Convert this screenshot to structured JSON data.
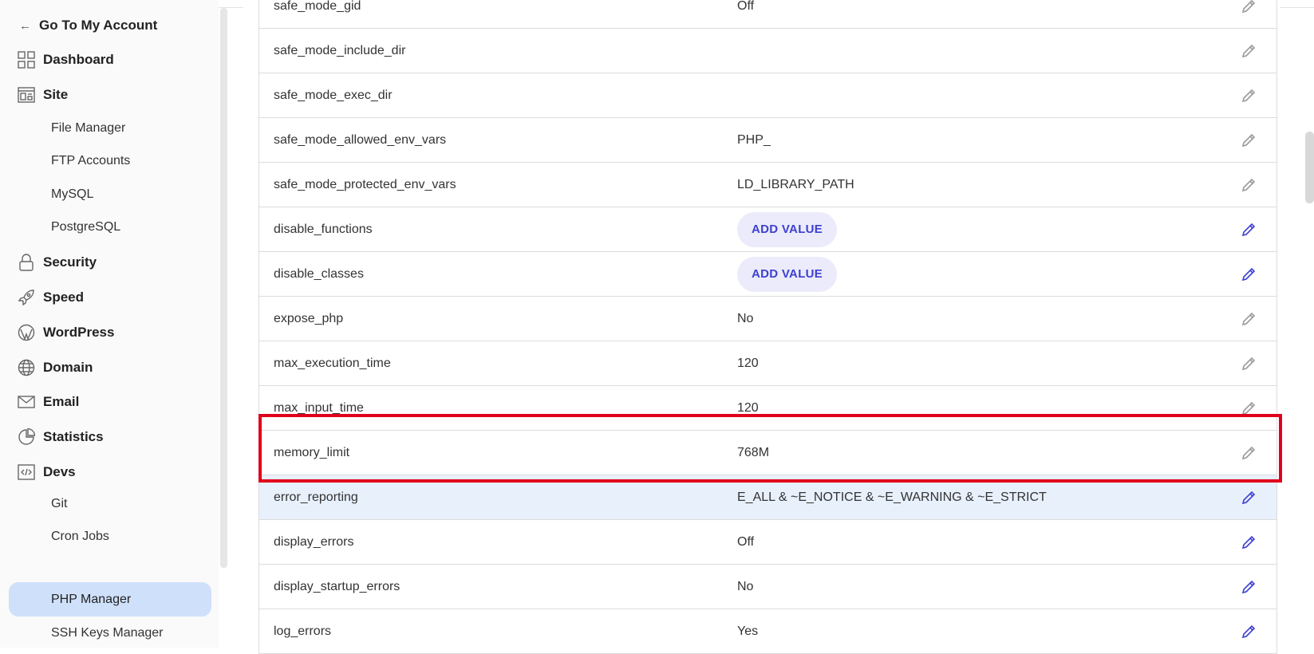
{
  "sidebar": {
    "back_label": "Go To My Account",
    "items": [
      {
        "label": "Dashboard",
        "icon": "dashboard-icon"
      },
      {
        "label": "Site",
        "icon": "site-icon"
      },
      {
        "label": "Security",
        "icon": "lock-icon"
      },
      {
        "label": "Speed",
        "icon": "rocket-icon"
      },
      {
        "label": "WordPress",
        "icon": "wordpress-icon"
      },
      {
        "label": "Domain",
        "icon": "globe-icon"
      },
      {
        "label": "Email",
        "icon": "mail-icon"
      },
      {
        "label": "Statistics",
        "icon": "pie-chart-icon"
      },
      {
        "label": "Devs",
        "icon": "code-icon"
      }
    ],
    "site_sub": [
      "File Manager",
      "FTP Accounts",
      "MySQL",
      "PostgreSQL"
    ],
    "devs_sub": [
      "Git",
      "Cron Jobs",
      "PHP Manager",
      "SSH Keys Manager"
    ],
    "active_sub": "PHP Manager"
  },
  "table": {
    "add_value_label": "ADD VALUE",
    "rows": [
      {
        "name": "safe_mode_gid",
        "value": "Off",
        "editable": false
      },
      {
        "name": "safe_mode_include_dir",
        "value": "",
        "editable": false
      },
      {
        "name": "safe_mode_exec_dir",
        "value": "",
        "editable": false
      },
      {
        "name": "safe_mode_allowed_env_vars",
        "value": "PHP_",
        "editable": false
      },
      {
        "name": "safe_mode_protected_env_vars",
        "value": "LD_LIBRARY_PATH",
        "editable": false
      },
      {
        "name": "disable_functions",
        "value": "",
        "editable": true,
        "add_value": true
      },
      {
        "name": "disable_classes",
        "value": "",
        "editable": true,
        "add_value": true
      },
      {
        "name": "expose_php",
        "value": "No",
        "editable": false
      },
      {
        "name": "max_execution_time",
        "value": "120",
        "editable": false
      },
      {
        "name": "max_input_time",
        "value": "120",
        "editable": false
      },
      {
        "name": "memory_limit",
        "value": "768M",
        "editable": false
      },
      {
        "name": "error_reporting",
        "value": "E_ALL & ~E_NOTICE & ~E_WARNING & ~E_STRICT",
        "editable": true,
        "selected": true
      },
      {
        "name": "display_errors",
        "value": "Off",
        "editable": true
      },
      {
        "name": "display_startup_errors",
        "value": "No",
        "editable": true
      },
      {
        "name": "log_errors",
        "value": "Yes",
        "editable": true
      }
    ]
  },
  "colors": {
    "accent": "#3d3fd0",
    "disabled_icon": "#9a9a9a",
    "highlight_border": "#e0001b",
    "selected_row": "#e8f0fc",
    "active_nav": "#cfe0fb"
  }
}
